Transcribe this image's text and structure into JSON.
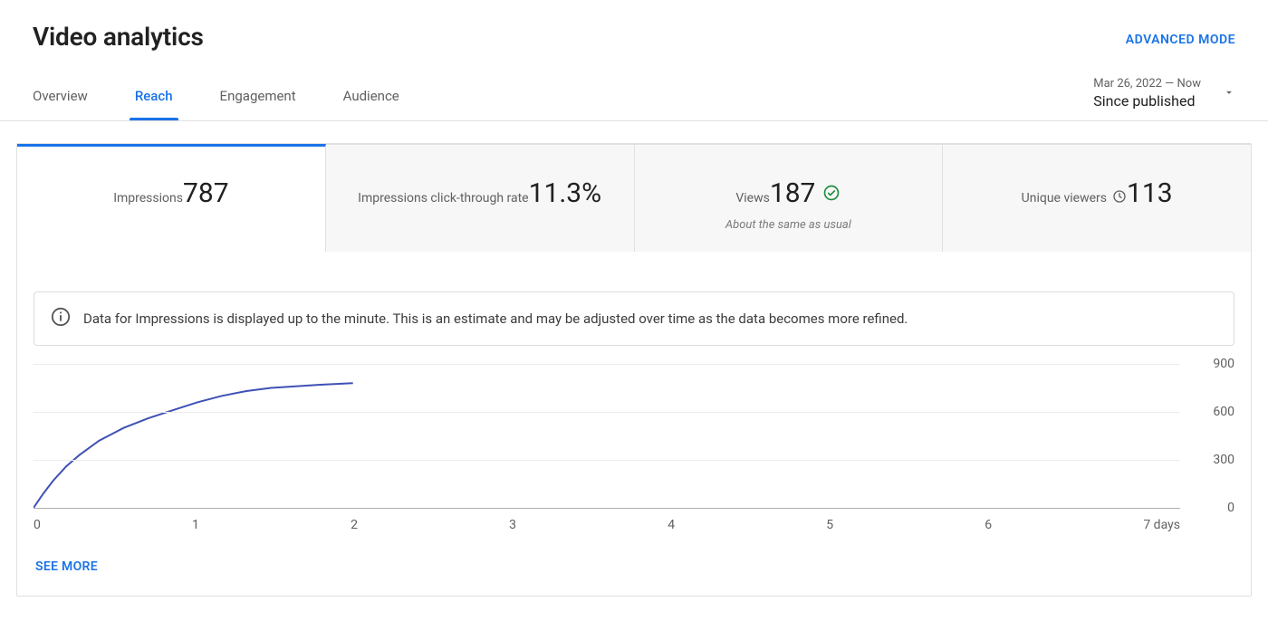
{
  "header": {
    "title": "Video analytics",
    "advanced_mode": "ADVANCED MODE"
  },
  "tabs": {
    "items": [
      "Overview",
      "Reach",
      "Engagement",
      "Audience"
    ],
    "active_index": 1
  },
  "date_picker": {
    "range": "Mar 26, 2022 — Now",
    "label": "Since published"
  },
  "metrics": {
    "active_index": 0,
    "items": [
      {
        "label": "Impressions",
        "value": "787",
        "has_check": false,
        "has_clock": false,
        "sub": ""
      },
      {
        "label": "Impressions click-through rate",
        "value": "11.3%",
        "has_check": false,
        "has_clock": false,
        "sub": ""
      },
      {
        "label": "Views",
        "value": "187",
        "has_check": true,
        "has_clock": false,
        "sub": "About the same as usual"
      },
      {
        "label": "Unique viewers",
        "value": "113",
        "has_check": false,
        "has_clock": true,
        "sub": ""
      }
    ]
  },
  "info_banner": {
    "text": "Data for Impressions is displayed up to the minute. This is an estimate and may be adjusted over time as the data becomes more refined."
  },
  "chart_data": {
    "type": "line",
    "title": "",
    "xlabel": "",
    "ylabel": "",
    "x_unit_suffix": "days",
    "xlim": [
      0,
      7
    ],
    "ylim": [
      0,
      900
    ],
    "x_ticks": [
      0,
      1,
      2,
      3,
      4,
      5,
      6,
      7
    ],
    "y_ticks": [
      0,
      300,
      600,
      900
    ],
    "series": [
      {
        "name": "Impressions",
        "color": "#3f51b5",
        "x": [
          0.0,
          0.06,
          0.12,
          0.2,
          0.28,
          0.4,
          0.55,
          0.7,
          0.85,
          1.0,
          1.15,
          1.3,
          1.45,
          1.6,
          1.75,
          1.85,
          1.95
        ],
        "values": [
          0,
          90,
          170,
          260,
          330,
          420,
          500,
          560,
          610,
          660,
          700,
          730,
          750,
          760,
          770,
          775,
          780
        ]
      }
    ]
  },
  "see_more": "SEE MORE"
}
